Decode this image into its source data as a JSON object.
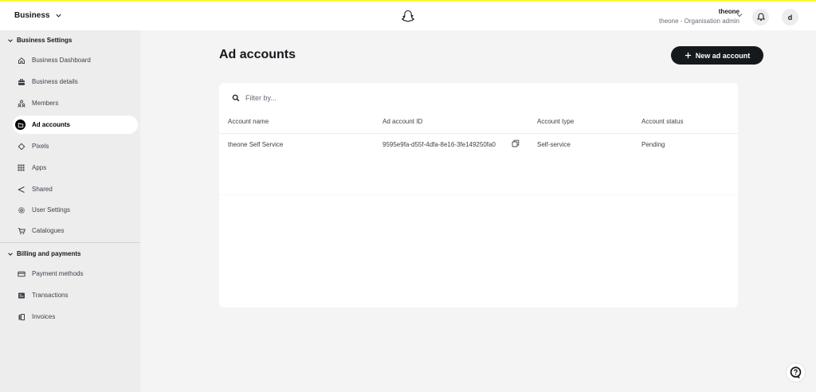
{
  "topbar": {
    "brand": "Business",
    "brand_icon": "chevron-down-icon",
    "logo_icon": "snapchat-ghost-icon",
    "user_name": "theone",
    "user_role": "theone - Organisation admin",
    "avatar_initial": "d",
    "accent_color": "#fffc00"
  },
  "sidebar": {
    "sections": [
      {
        "label": "Business Settings",
        "items": [
          {
            "label": "Business Dashboard",
            "icon": "home-icon"
          },
          {
            "label": "Business details",
            "icon": "briefcase-icon"
          },
          {
            "label": "Members",
            "icon": "members-icon"
          },
          {
            "label": "Ad accounts",
            "icon": "folder-icon",
            "active": true
          },
          {
            "label": "Pixels",
            "icon": "diamond-icon"
          },
          {
            "label": "Apps",
            "icon": "grid-icon"
          },
          {
            "label": "Shared",
            "icon": "share-icon"
          },
          {
            "label": "User Settings",
            "icon": "gear-icon"
          },
          {
            "label": "Catalogues",
            "icon": "cart-icon"
          }
        ]
      },
      {
        "label": "Billing and payments",
        "items": [
          {
            "label": "Payment methods",
            "icon": "credit-card-icon"
          },
          {
            "label": "Transactions",
            "icon": "receipt-icon"
          },
          {
            "label": "Invoices",
            "icon": "invoice-icon"
          }
        ]
      }
    ]
  },
  "main": {
    "title": "Ad accounts",
    "new_button": "New ad account",
    "filter_placeholder": "Filter by...",
    "table": {
      "columns": [
        "Account name",
        "Ad account ID",
        "Account type",
        "Account status"
      ],
      "rows": [
        [
          "theone Self Service",
          "9595e9fa-d55f-4dfa-8e16-3fe149250fa0",
          "Self-service",
          "Pending"
        ]
      ]
    }
  },
  "help_icon": "help-icon"
}
